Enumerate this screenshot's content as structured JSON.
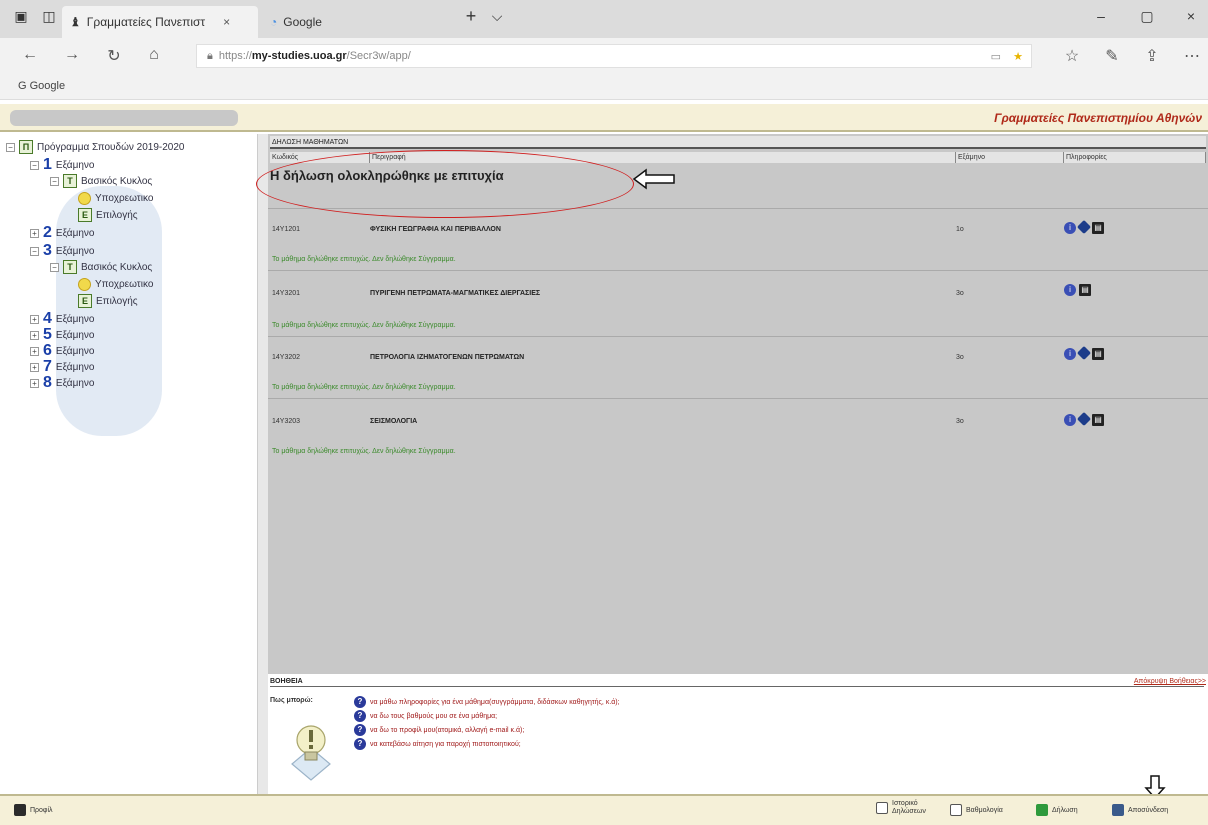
{
  "browser": {
    "tabs": [
      {
        "label": "Γραμματείες Πανεπιστ",
        "close": "×"
      },
      {
        "label": "Google"
      }
    ],
    "new_tab": "+",
    "tab_menu": "⌵",
    "window_controls": {
      "minimize": "–",
      "maximize": "▢",
      "close": "×"
    },
    "nav": {
      "back": "←",
      "forward": "→",
      "refresh": "↻",
      "home": "⌂"
    },
    "url_protocol": "https://",
    "url_host": "my-studies.uoa.gr",
    "url_path": "/Secr3w/app/",
    "bookmark": "G Google"
  },
  "header": {
    "site_title": "Γραμματείες Πανεπιστημίου Αθηνών"
  },
  "sidebar": {
    "root": "Πρόγραμμα Σπουδών 2019-2020",
    "semester_label": "Εξάμηνο",
    "semesters": [
      "1",
      "2",
      "3",
      "4",
      "5",
      "6",
      "7",
      "8"
    ],
    "cycle_label": "Βασικός Κυκλος",
    "mandatory_label": "Υποχρεωτικο",
    "elective_label": "Επιλογής"
  },
  "main": {
    "section_title": "ΔΗΛΩΣΗ ΜΑΘΗΜΑΤΩΝ",
    "columns": [
      "Κωδικός",
      "Περιγραφή",
      "Εξάμηνο",
      "Πληροφορίες"
    ],
    "success_message": "Η δήλωση ολοκληρώθηκε με επιτυχία",
    "courses": [
      {
        "code": "14Υ1201",
        "title": "ΦΥΣΙΚΗ ΓΕΩΓΡΑΦΙΑ ΚΑΙ ΠΕΡΙΒΑΛΛΟΝ",
        "semester": "1ο",
        "icons": [
          "info-icon",
          "book-icon",
          "document-icon"
        ]
      },
      {
        "code": "14Υ3201",
        "title": "ΠΥΡΙΓΕΝΗ ΠΕΤΡΩΜΑΤΑ-ΜΑΓΜΑΤΙΚΕΣ ΔΙΕΡΓΑΣΙΕΣ",
        "semester": "3ο",
        "icons": [
          "info-icon",
          "document-icon"
        ]
      },
      {
        "code": "14Υ3202",
        "title": "ΠΕΤΡΟΛΟΓΙΑ ΙΖΗΜΑΤΟΓΕΝΩΝ ΠΕΤΡΩΜΑΤΩΝ",
        "semester": "3ο",
        "icons": [
          "info-icon",
          "book-icon",
          "document-icon"
        ]
      },
      {
        "code": "14Υ3203",
        "title": "ΣΕΙΣΜΟΛΟΓΙΑ",
        "semester": "3ο",
        "icons": [
          "info-icon",
          "book-icon",
          "document-icon"
        ]
      }
    ],
    "course_note": "Το μάθημα δηλώθηκε επιτυχώς. Δεν δηλώθηκε Σύγγραμμα."
  },
  "help": {
    "title": "ΒΟΗΘΕΙΑ",
    "close_link": "Απόκρυψη Βοήθειας>>",
    "ask": "Πως μπορώ:",
    "items": [
      "να μάθω πληροφορίες για ένα μάθημα(συγγράμματα, διδάσκων καθηγητής, κ.ά);",
      "να δω τους βαθμούς μου σε ένα μάθημα;",
      "να δω το προφίλ μου(ατομικά, αλλαγή e-mail κ.ά);",
      "να κατεβάσω αίτηση για παροχή πιστοποιητικού;"
    ]
  },
  "bottom": {
    "profile": "Προφίλ",
    "history_line1": "Ιστορικό",
    "history_line2": "Δηλώσεων",
    "grades": "Βαθμολογία",
    "declaration": "Δήλωση",
    "logout": "Αποσύνδεση"
  }
}
